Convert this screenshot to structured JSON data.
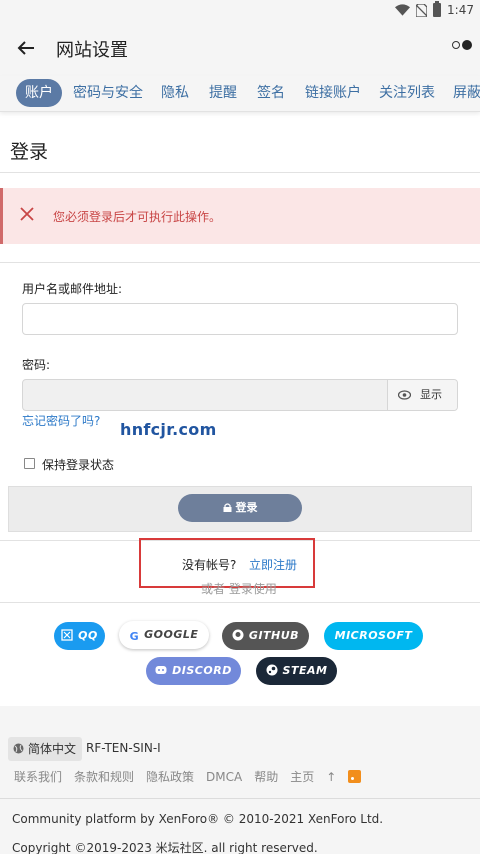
{
  "status_bar": {
    "time": "1:47"
  },
  "app_bar": {
    "title": "网站设置"
  },
  "tabs": [
    {
      "label": "账户"
    },
    {
      "label": "密码与安全"
    },
    {
      "label": "隐私"
    },
    {
      "label": "提醒"
    },
    {
      "label": "签名"
    },
    {
      "label": "链接账户"
    },
    {
      "label": "关注列表"
    },
    {
      "label": "屏蔽"
    }
  ],
  "page_title": "登录",
  "error": {
    "message": "您必须登录后才可执行此操作。"
  },
  "form": {
    "username_label": "用户名或邮件地址:",
    "username_value": "",
    "password_label": "密码:",
    "password_value": "",
    "show_label": "显示",
    "forgot_label": "忘记密码了吗?",
    "remember_label": "保持登录状态",
    "login_label": "登录"
  },
  "watermark": "hnfcjr.com",
  "register": {
    "question": "没有帐号?",
    "link": "立即注册",
    "or_text": "或者 登录使用"
  },
  "social": [
    {
      "label": "QQ",
      "color": "#1a9bf0",
      "text_color": "#ffffff"
    },
    {
      "label": "GOOGLE",
      "color": "#ffffff",
      "text_color": "#444444"
    },
    {
      "label": "GITHUB",
      "color": "#555555",
      "text_color": "#ffffff"
    },
    {
      "label": "MICROSOFT",
      "color": "#00b7f0",
      "text_color": "#ffffff"
    },
    {
      "label": "DISCORD",
      "color": "#7289da",
      "text_color": "#ffffff"
    },
    {
      "label": "STEAM",
      "color": "#1b2838",
      "text_color": "#ffffff"
    }
  ],
  "footer": {
    "language": "简体中文",
    "style": "RF-TEN-SIN-I",
    "links": [
      "联系我们",
      "条款和规则",
      "隐私政策",
      "DMCA",
      "帮助",
      "主页",
      "↑"
    ],
    "copyright_line1": "Community platform by XenForo® © 2010-2021 XenForo Ltd.",
    "copyright_line2": "Copyright ©2019-2023 米坛社区. all right reserved."
  },
  "colors": {
    "accent": "#5b7aa5",
    "link": "#2c79c8",
    "error_text": "#c84545",
    "error_bg": "#fbe6e6",
    "highlight_box": "#d83a3a"
  }
}
